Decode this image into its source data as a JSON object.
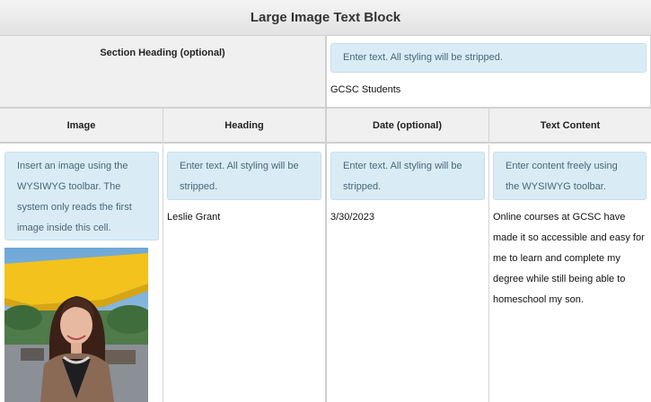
{
  "title": "Large Image Text Block",
  "section": {
    "heading_label": "Section Heading (optional)",
    "input_hint": "Enter text. All styling will be stripped.",
    "value": "GCSC Students"
  },
  "columns": {
    "image": "Image",
    "heading": "Heading",
    "date": "Date (optional)",
    "text": "Text Content"
  },
  "hints": {
    "image": "Insert an image using the WYSIWYG toolbar. The system only reads the first image inside this cell.",
    "heading": "Enter text. All styling will be stripped.",
    "date": "Enter text. All styling will be stripped.",
    "text": "Enter content freely using the WYSIWYG toolbar."
  },
  "row": {
    "heading": "Leslie Grant",
    "date": "3/30/2023",
    "text": "Online courses at GCSC have made it so accessible and easy for me to learn and complete my degree while still being able to homeschool my son."
  }
}
